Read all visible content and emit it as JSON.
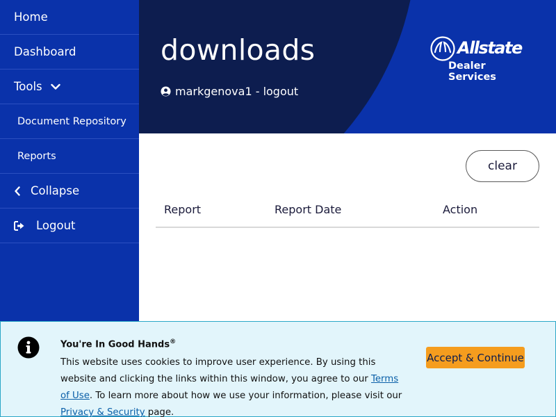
{
  "sidebar": {
    "items": [
      {
        "label": "Home"
      },
      {
        "label": "Dashboard"
      },
      {
        "label": "Tools"
      },
      {
        "label": "Document Repository"
      },
      {
        "label": "Reports"
      },
      {
        "label": "Collapse"
      },
      {
        "label": "Logout"
      }
    ]
  },
  "header": {
    "title": "downloads",
    "user_text": "markgenova1 - logout",
    "logo_word": "Allstate",
    "logo_sub": "Dealer Services"
  },
  "main": {
    "clear_label": "clear",
    "table": {
      "columns": [
        "Report",
        "Report Date",
        "Action"
      ],
      "rows": []
    }
  },
  "cookie": {
    "title": "You're In Good Hands",
    "title_mark": "®",
    "text_before_terms": "This website uses cookies to improve user experience. By using this website and clicking the links within this window, you agree to our ",
    "terms_link": "Terms of Use",
    "text_middle": ". To learn more about how we use your information, please visit our ",
    "privacy_link": "Privacy & Security",
    "text_after": " page.",
    "accept_label": "Accept & Continue"
  },
  "colors": {
    "brand_blue": "#0a32aa",
    "navy": "#0d1d4f",
    "accept_orange": "#f59d1e",
    "banner_bg": "#e2f5fb"
  }
}
